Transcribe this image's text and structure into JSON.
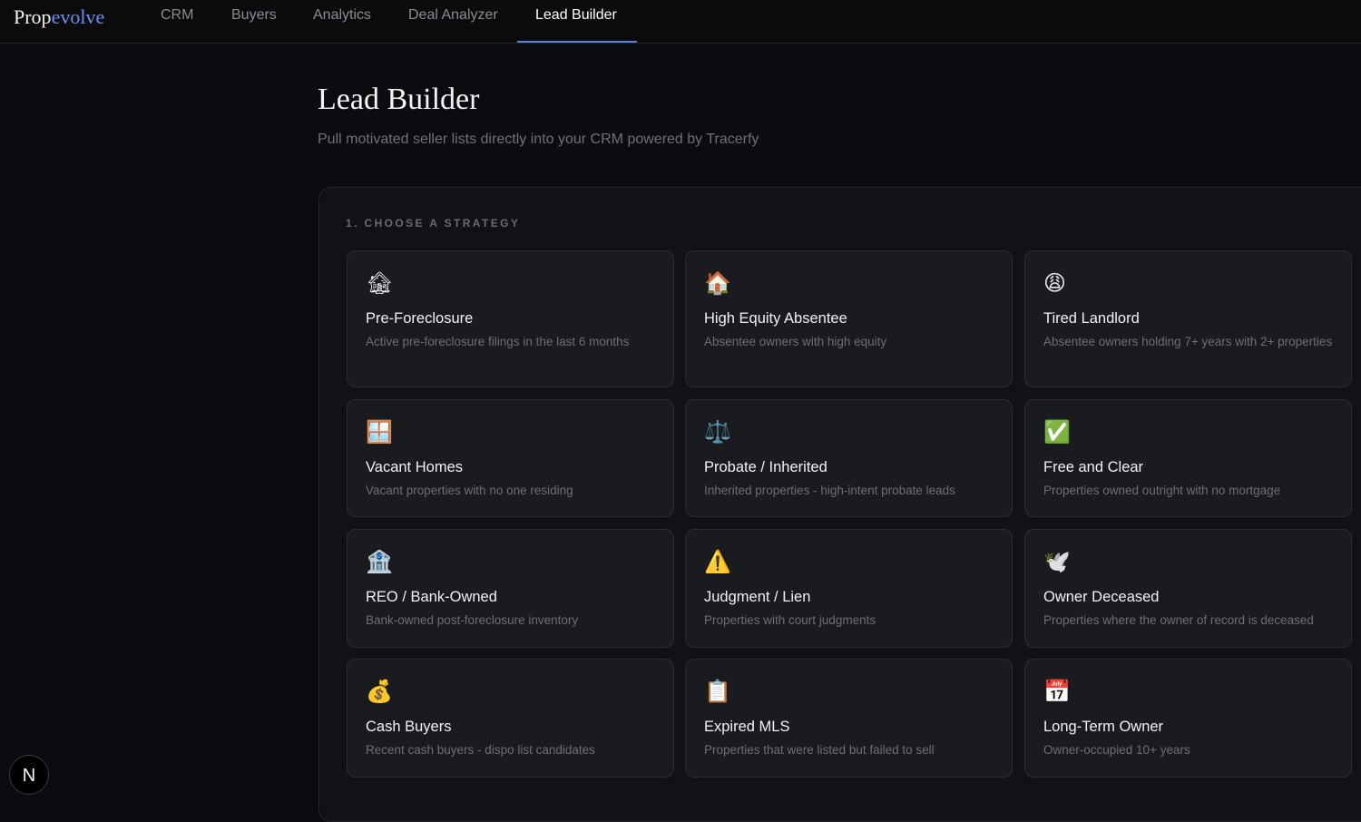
{
  "app": {
    "logo_part1": "Prop",
    "logo_part2": "evolve"
  },
  "nav": {
    "tabs": [
      {
        "label": "CRM"
      },
      {
        "label": "Buyers"
      },
      {
        "label": "Analytics"
      },
      {
        "label": "Deal Analyzer"
      },
      {
        "label": "Lead Builder",
        "active": true
      }
    ],
    "active_color": "#5b7fe0"
  },
  "page": {
    "title": "Lead Builder",
    "subtitle": "Pull motivated seller lists directly into your CRM powered by Tracerfy"
  },
  "strategy_section": {
    "label": "1. CHOOSE A STRATEGY",
    "cards": [
      {
        "icon": "🏚",
        "icon_name": "house-notice-icon",
        "title": "Pre-Foreclosure",
        "desc": "Active pre-foreclosure filings in the last 6 months"
      },
      {
        "icon": "🏠",
        "icon_name": "house-icon",
        "title": "High Equity Absentee",
        "desc": "Absentee owners with high equity"
      },
      {
        "icon": "😩",
        "icon_name": "weary-face-icon",
        "title": "Tired Landlord",
        "desc": "Absentee owners holding 7+ years with 2+ properties"
      },
      {
        "icon": "🪟",
        "icon_name": "window-icon",
        "title": "Vacant Homes",
        "desc": "Vacant properties with no one residing"
      },
      {
        "icon": "⚖️",
        "icon_name": "scales-icon",
        "title": "Probate / Inherited",
        "desc": "Inherited properties - high-intent probate leads"
      },
      {
        "icon": "✅",
        "icon_name": "check-mark-icon",
        "title": "Free and Clear",
        "desc": "Properties owned outright with no mortgage"
      },
      {
        "icon": "🏦",
        "icon_name": "bank-icon",
        "title": "REO / Bank-Owned",
        "desc": "Bank-owned post-foreclosure inventory"
      },
      {
        "icon": "⚠️",
        "icon_name": "warning-icon",
        "title": "Judgment / Lien",
        "desc": "Properties with court judgments"
      },
      {
        "icon": "🕊️",
        "icon_name": "dove-icon",
        "title": "Owner Deceased",
        "desc": "Properties where the owner of record is deceased"
      },
      {
        "icon": "💰",
        "icon_name": "money-bag-icon",
        "title": "Cash Buyers",
        "desc": "Recent cash buyers - dispo list candidates"
      },
      {
        "icon": "📋",
        "icon_name": "clipboard-icon",
        "title": "Expired MLS",
        "desc": "Properties that were listed but failed to sell"
      },
      {
        "icon": "📅",
        "icon_name": "calendar-icon",
        "title": "Long-Term Owner",
        "desc": "Owner-occupied 10+ years"
      }
    ]
  },
  "dev_badge": {
    "label": "N"
  }
}
